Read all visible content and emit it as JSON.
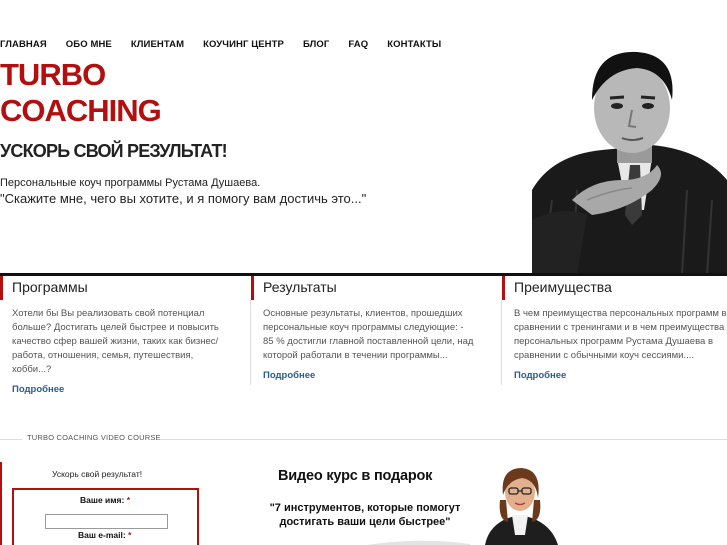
{
  "nav": {
    "items": [
      "ГЛАВНАЯ",
      "ОБО МНЕ",
      "КЛИЕНТАМ",
      "КОУЧИНГ ЦЕНТР",
      "БЛОГ",
      "FAQ",
      "КОНТАКТЫ"
    ]
  },
  "logo": {
    "line1": "TURBO",
    "line2": "COACHING"
  },
  "hero": {
    "tagline": "УСКОРЬ СВОЙ РЕЗУЛЬТАТ!",
    "intro": "Персональные коуч программы Рустама Душаева.",
    "quote": "\"Скажите мне, чего вы хотите, и я помогу вам достичь это...\""
  },
  "columns": [
    {
      "title": "Программы",
      "text": "Хотели бы Вы реализовать свой потенциал больше? Достигать целей быстрее и повысить качество сфер вашей жизни, таких как бизнес/работа, отношения, семья, путешествия, хобби...?",
      "more": "Подробнее"
    },
    {
      "title": "Результаты",
      "text": "Основные результаты, клиентов, прошедших персональные коуч программы следующие: - 85 % достигли главной поставленной цели, над которой работали в течении программы...",
      "more": "Подробнее"
    },
    {
      "title": "Преимущества",
      "text": "В чем преимущества персональных программ в сравнении с тренингами и в чем преимущества персональных программ Рустама Душаева в сравнении с обычными коуч сессиями....",
      "more": "Подробнее"
    }
  ],
  "course": {
    "label": "TURBO COACHING VIDEO COURSE",
    "form_title": "Ускорь свой результат!",
    "name_label": "Ваше имя:",
    "email_label": "Ваш e-mail:",
    "required_mark": "*",
    "name_value": "",
    "email_value": "",
    "promo_title": "Видео курс в подарок",
    "promo_quote": "\"7 инструментов, которые помогут достигать ваши цели быстрее\""
  },
  "colors": {
    "accent": "#b30f0f",
    "link": "#2a5d8f"
  }
}
